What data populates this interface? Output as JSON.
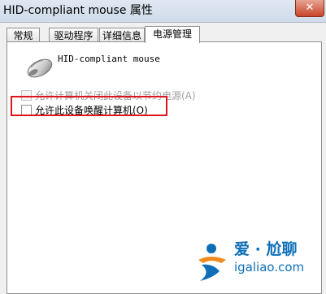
{
  "window": {
    "title": "HID-compliant mouse 属性",
    "close_glyph": "✕"
  },
  "tabs": [
    {
      "label": "常规",
      "active": false
    },
    {
      "label": "驱动程序",
      "active": false
    },
    {
      "label": "详细信息",
      "active": false
    },
    {
      "label": "电源管理",
      "active": true
    }
  ],
  "device": {
    "icon": "mouse-icon",
    "name": "HID-compliant mouse"
  },
  "options": [
    {
      "label": "允许计算机关闭此设备以节约电源(A)",
      "checked": false,
      "enabled": false
    },
    {
      "label": "允许此设备唤醒计算机(O)",
      "checked": false,
      "enabled": true
    }
  ],
  "colors": {
    "highlight": "#e0141c",
    "watermark": "#0e6fb8",
    "watermark_accent": "#f08a1c"
  },
  "watermark": {
    "cn": "爱 · 尬聊",
    "url": "igaliao.com"
  }
}
